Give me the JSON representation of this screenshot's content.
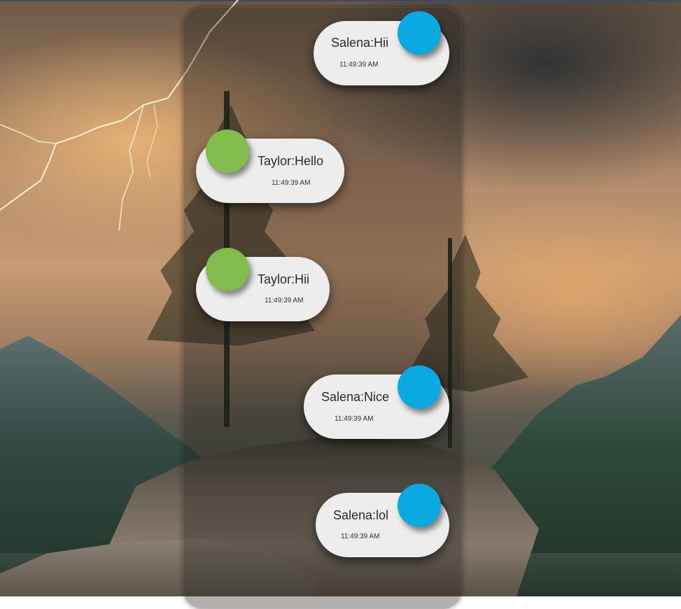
{
  "messages": [
    {
      "sender": "Salena",
      "text": "Salena:Hii",
      "time": "11:49:39 AM",
      "side": "right",
      "avatar_color": "#0aa9e2"
    },
    {
      "sender": "Taylor",
      "text": "Taylor:Hello",
      "time": "11:49:39 AM",
      "side": "left",
      "avatar_color": "#82bc4c"
    },
    {
      "sender": "Taylor",
      "text": "Taylor:Hii",
      "time": "11:49:39 AM",
      "side": "left",
      "avatar_color": "#82bc4c"
    },
    {
      "sender": "Salena",
      "text": "Salena:Nice",
      "time": "11:49:39 AM",
      "side": "right",
      "avatar_color": "#0aa9e2"
    },
    {
      "sender": "Salena",
      "text": "Salena:lol",
      "time": "11:49:39 AM",
      "side": "right",
      "avatar_color": "#0aa9e2"
    }
  ],
  "colors": {
    "bubble": "#ededed",
    "salena_avatar": "#0aa9e2",
    "taylor_avatar": "#82bc4c"
  },
  "background": "stormy lake landscape with lightning, trees on rocky island"
}
